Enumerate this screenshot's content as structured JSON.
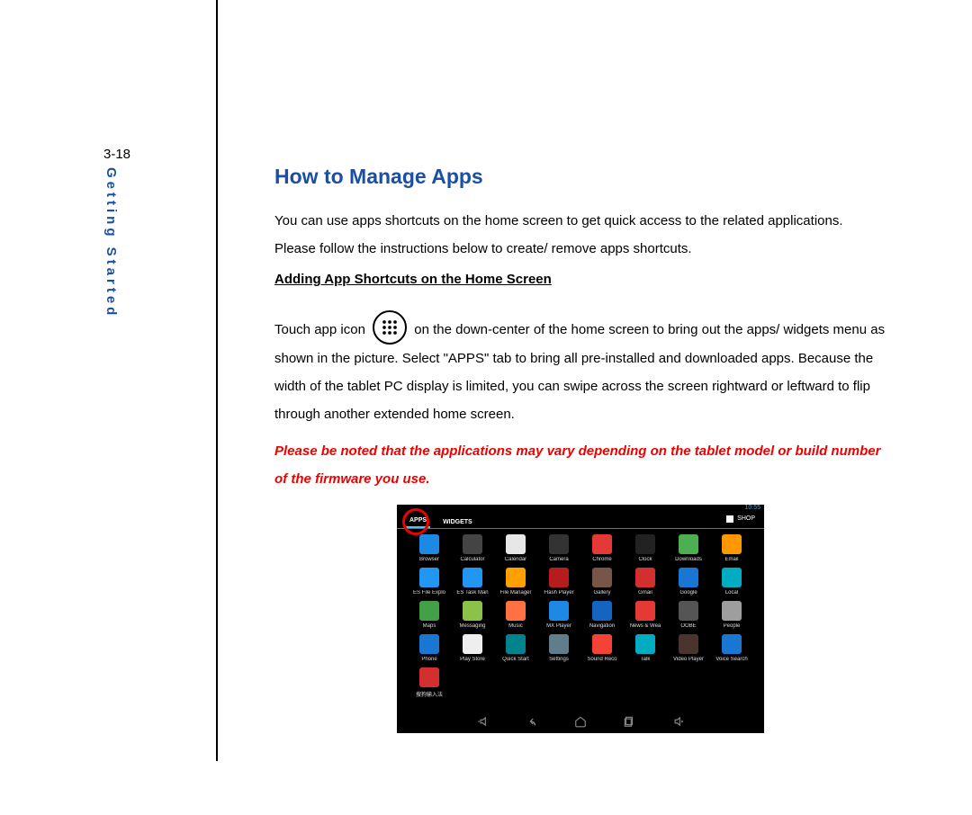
{
  "page_number": "3-18",
  "section": "Getting Started",
  "title": "How to Manage Apps",
  "intro": "You can use apps shortcuts on the home screen to get quick access to the related applications. Please follow the instructions below to create/ remove apps shortcuts.",
  "subheading": "Adding App Shortcuts on the Home Screen",
  "para2a": "Touch app icon ",
  "para2b": " on the down-center of the home screen to bring out the apps/ widgets menu as shown in the picture. Select \"APPS\" tab to bring all pre-installed and downloaded apps. Because the width of the tablet PC display is limited, you can swipe across the screen rightward or leftward to flip through another extended home screen.",
  "note": "Please be noted that the applications may vary depending on the tablet model or build number of the firmware you use.",
  "tablet": {
    "status_time": "10:55",
    "tabs": {
      "apps": "APPS",
      "widgets": "WIDGETS"
    },
    "shop": "SHOP",
    "apps": [
      {
        "name": "Browser",
        "color": "#1e88e5"
      },
      {
        "name": "Calculator",
        "color": "#444"
      },
      {
        "name": "Calendar",
        "color": "#e7e7e7"
      },
      {
        "name": "Camera",
        "color": "#333"
      },
      {
        "name": "Chrome",
        "color": "#e53935"
      },
      {
        "name": "Clock",
        "color": "#222"
      },
      {
        "name": "Downloads",
        "color": "#4caf50"
      },
      {
        "name": "Email",
        "color": "#ff9800"
      },
      {
        "name": "ES File Explo",
        "color": "#2196f3"
      },
      {
        "name": "ES Task Man",
        "color": "#2196f3"
      },
      {
        "name": "File Manager",
        "color": "#ffa000"
      },
      {
        "name": "Flash Player",
        "color": "#b71c1c"
      },
      {
        "name": "Gallery",
        "color": "#795548"
      },
      {
        "name": "Gmail",
        "color": "#d32f2f"
      },
      {
        "name": "Google",
        "color": "#1976d2"
      },
      {
        "name": "Local",
        "color": "#00acc1"
      },
      {
        "name": "Maps",
        "color": "#43a047"
      },
      {
        "name": "Messaging",
        "color": "#8bc34a"
      },
      {
        "name": "Music",
        "color": "#ff7043"
      },
      {
        "name": "MX Player",
        "color": "#1e88e5"
      },
      {
        "name": "Navigation",
        "color": "#1565c0"
      },
      {
        "name": "News & Wea",
        "color": "#e53935"
      },
      {
        "name": "OOBE",
        "color": "#555"
      },
      {
        "name": "People",
        "color": "#9e9e9e"
      },
      {
        "name": "Phone",
        "color": "#1976d2"
      },
      {
        "name": "Play Store",
        "color": "#eee"
      },
      {
        "name": "Quick Start",
        "color": "#00838f"
      },
      {
        "name": "Settings",
        "color": "#607d8b"
      },
      {
        "name": "Sound Reco",
        "color": "#f44336"
      },
      {
        "name": "Talk",
        "color": "#00acc1"
      },
      {
        "name": "Video Player",
        "color": "#4a342e"
      },
      {
        "name": "Voice Search",
        "color": "#1976d2"
      },
      {
        "name": "搜狗输入法",
        "color": "#d32f2f"
      }
    ]
  }
}
